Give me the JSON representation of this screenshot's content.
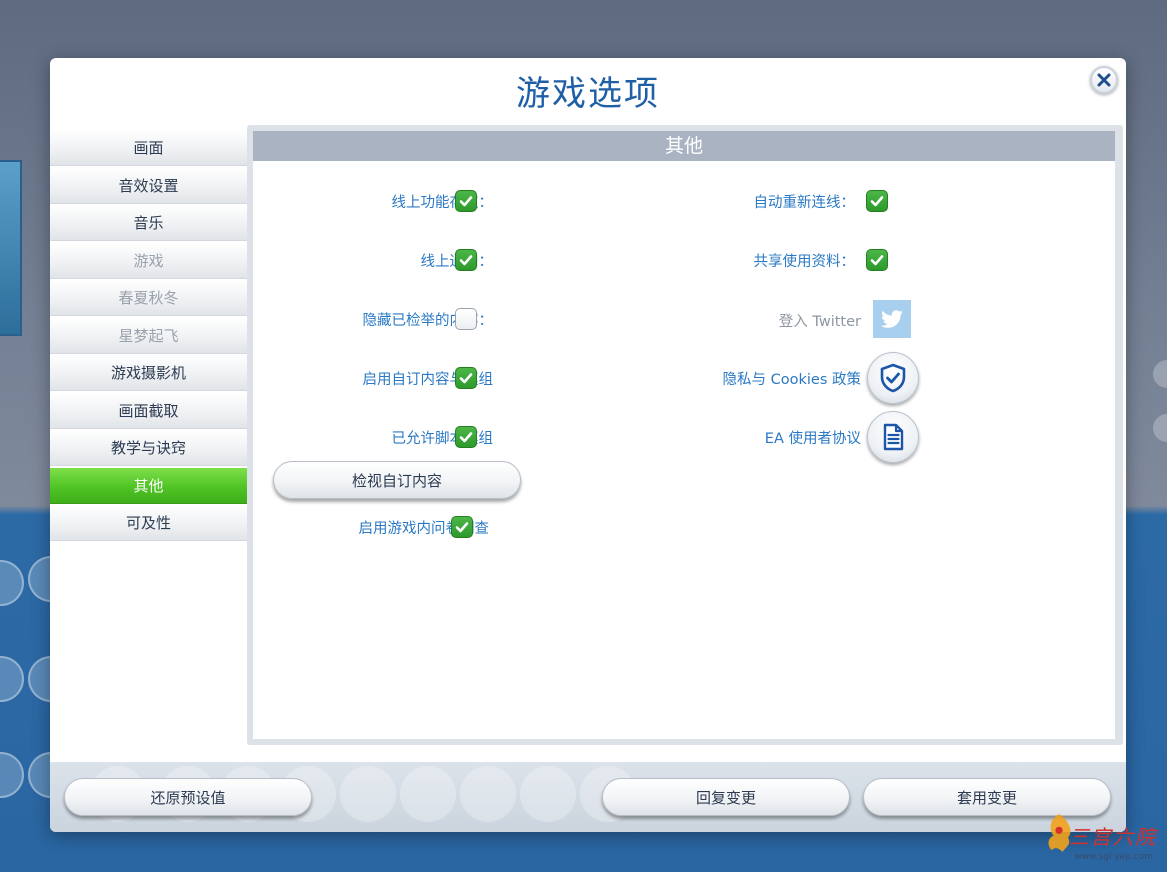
{
  "dialog": {
    "title": "游戏选项",
    "close_icon": "close-icon"
  },
  "sidebar": {
    "items": [
      {
        "label": "画面",
        "state": "normal"
      },
      {
        "label": "音效设置",
        "state": "normal"
      },
      {
        "label": "音乐",
        "state": "normal"
      },
      {
        "label": "游戏",
        "state": "disabled"
      },
      {
        "label": "春夏秋冬",
        "state": "disabled"
      },
      {
        "label": "星梦起飞",
        "state": "disabled"
      },
      {
        "label": "游戏摄影机",
        "state": "normal"
      },
      {
        "label": "画面截取",
        "state": "normal"
      },
      {
        "label": "教学与诀窍",
        "state": "normal"
      },
      {
        "label": "其他",
        "state": "active"
      },
      {
        "label": "可及性",
        "state": "normal"
      }
    ]
  },
  "panel": {
    "header": "其他",
    "left_options": [
      {
        "label": "线上功能存取：",
        "checked": true
      },
      {
        "label": "线上通知：",
        "checked": true
      },
      {
        "label": "隐藏已检举的内容：",
        "checked": false
      },
      {
        "label": "启用自订内容与模组",
        "checked": true
      },
      {
        "label": "已允许脚本模组",
        "checked": true
      }
    ],
    "view_custom_button": "检视自订内容",
    "survey_option": {
      "label": "启用游戏内问卷调查",
      "checked": true
    },
    "right_options": [
      {
        "label": "自动重新连线：",
        "checked": true
      },
      {
        "label": "共享使用资料：",
        "checked": true
      }
    ],
    "twitter": {
      "label": "登入 Twitter",
      "icon": "twitter-icon"
    },
    "privacy": {
      "label": "隐私与 Cookies 政策",
      "icon": "shield-check-icon"
    },
    "eula": {
      "label": "EA 使用者协议",
      "icon": "document-icon"
    }
  },
  "footer": {
    "restore_defaults": "还原预设值",
    "revert_changes": "回复变更",
    "apply_changes": "套用变更"
  },
  "watermark": {
    "text": "三宫六院",
    "url": "www.sgl yep.com"
  },
  "colors": {
    "accent_blue": "#2a79c4",
    "active_green": "#4fc425",
    "check_green": "#2e9a2c"
  }
}
